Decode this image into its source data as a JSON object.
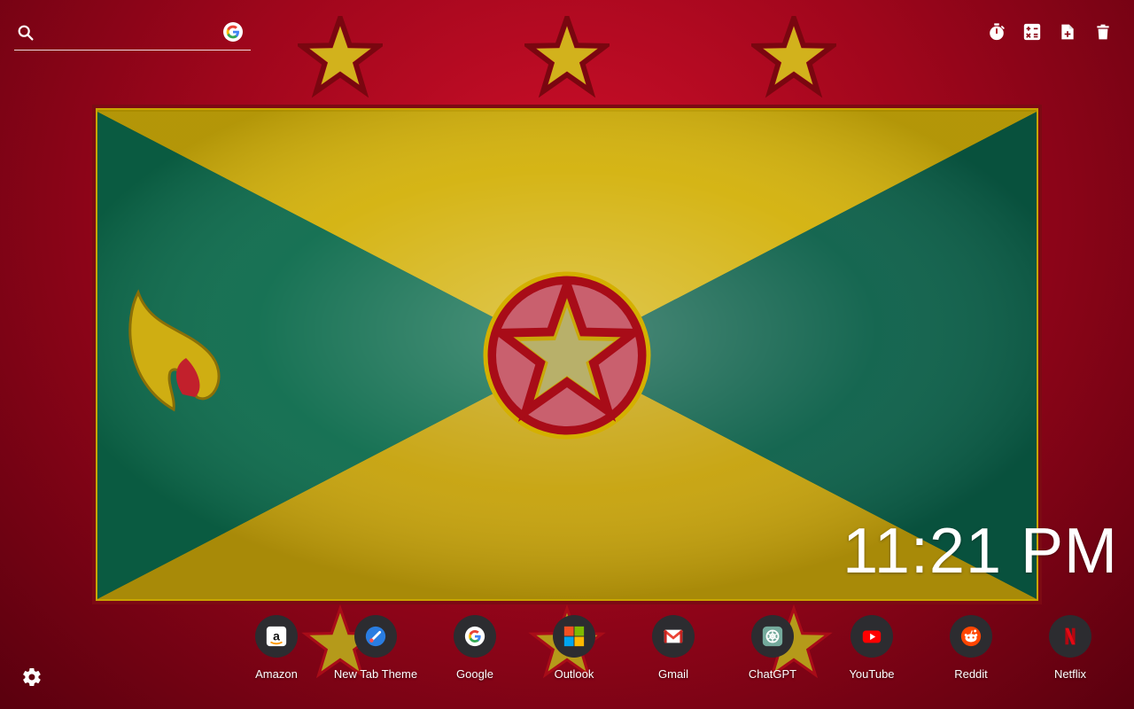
{
  "search": {
    "value": "",
    "placeholder": ""
  },
  "tools": [
    {
      "id": "timer",
      "icon": "timer-icon"
    },
    {
      "id": "calculator",
      "icon": "calculator-icon"
    },
    {
      "id": "add-note",
      "icon": "add-note-icon"
    },
    {
      "id": "delete",
      "icon": "trash-icon"
    }
  ],
  "clock": {
    "time": "11:21 PM"
  },
  "shortcuts": [
    {
      "label": "Amazon",
      "icon": "amazon-icon"
    },
    {
      "label": "New Tab Theme",
      "icon": "new-tab-theme-icon"
    },
    {
      "label": "Google",
      "icon": "google-icon"
    },
    {
      "label": "Outlook",
      "icon": "outlook-icon"
    },
    {
      "label": "Gmail",
      "icon": "gmail-icon"
    },
    {
      "label": "ChatGPT",
      "icon": "chatgpt-icon"
    },
    {
      "label": "YouTube",
      "icon": "youtube-icon"
    },
    {
      "label": "Reddit",
      "icon": "reddit-icon"
    },
    {
      "label": "Netflix",
      "icon": "netflix-icon"
    }
  ],
  "colors": {
    "background_red": "#c8102e",
    "flag_green": "#0a6b4a",
    "flag_yellow": "#d4b000",
    "shortcut_circle": "#2c2c30"
  }
}
